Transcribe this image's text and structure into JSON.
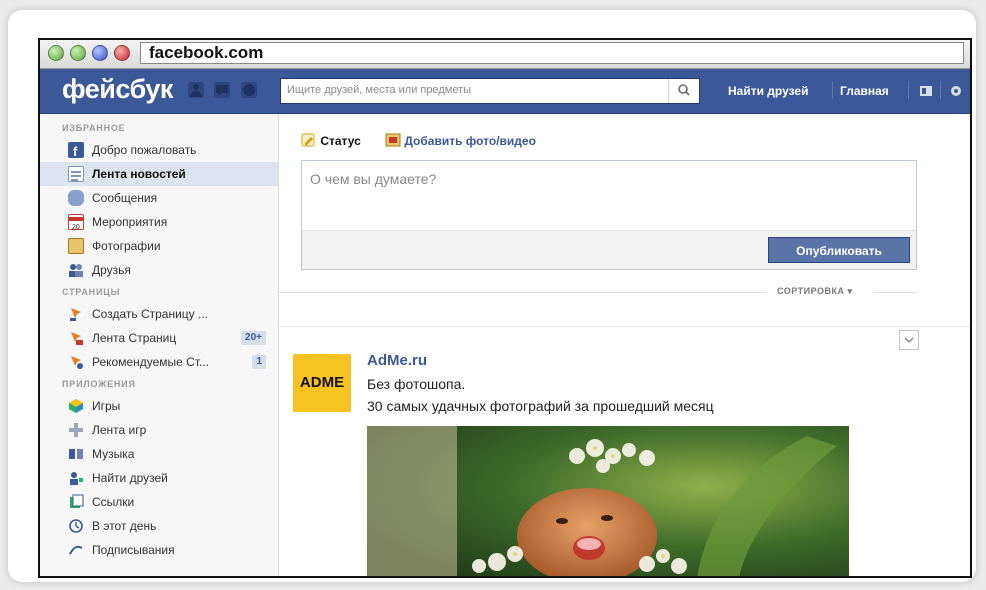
{
  "browser": {
    "url": "facebook.com"
  },
  "topbar": {
    "logo": "фейсбук",
    "search_placeholder": "Ищите друзей, места или предметы",
    "find_friends": "Найти друзей",
    "home": "Главная"
  },
  "sidebar": {
    "favorites_header": "ИЗБРАННОЕ",
    "favorites": [
      {
        "label": "Добро пожаловать",
        "icon": "facebook-icon"
      },
      {
        "label": "Лента новостей",
        "icon": "news-feed-icon"
      },
      {
        "label": "Сообщения",
        "icon": "messages-icon"
      },
      {
        "label": "Мероприятия",
        "icon": "events-icon"
      },
      {
        "label": "Фотографии",
        "icon": "photos-icon"
      },
      {
        "label": "Друзья",
        "icon": "friends-icon"
      }
    ],
    "pages_header": "СТРАНИЦЫ",
    "pages": [
      {
        "label": "Создать Страницу ...",
        "icon": "create-page-icon"
      },
      {
        "label": "Лента Страниц",
        "icon": "pages-feed-icon",
        "badge": "20+"
      },
      {
        "label": "Рекомендуемые Ст...",
        "icon": "suggested-pages-icon",
        "badge": "1"
      }
    ],
    "apps_header": "ПРИЛОЖЕНИЯ",
    "apps": [
      {
        "label": "Игры",
        "icon": "games-icon"
      },
      {
        "label": "Лента игр",
        "icon": "games-feed-icon"
      },
      {
        "label": "Музыка",
        "icon": "music-icon"
      },
      {
        "label": "Найти друзей",
        "icon": "find-friends-icon"
      },
      {
        "label": "Ссылки",
        "icon": "links-icon"
      },
      {
        "label": "В этот день",
        "icon": "on-this-day-icon"
      },
      {
        "label": "Подписывания",
        "icon": "pokes-icon"
      }
    ]
  },
  "composer": {
    "tab_status": "Статус",
    "tab_photo": "Добавить фото/видео",
    "placeholder": "О чем вы думаете?",
    "publish": "Опубликовать"
  },
  "feed": {
    "sort_label": "СОРТИРОВКА ▾",
    "post": {
      "avatar_text": "ADME",
      "author": "AdMe.ru",
      "line1": "Без фотошопа.",
      "line2": "30 самых удачных фотографий за прошедший месяц"
    }
  },
  "colors": {
    "brand": "#3b5998",
    "adme": "#f7c321",
    "publish_button": "#5b74a8"
  }
}
